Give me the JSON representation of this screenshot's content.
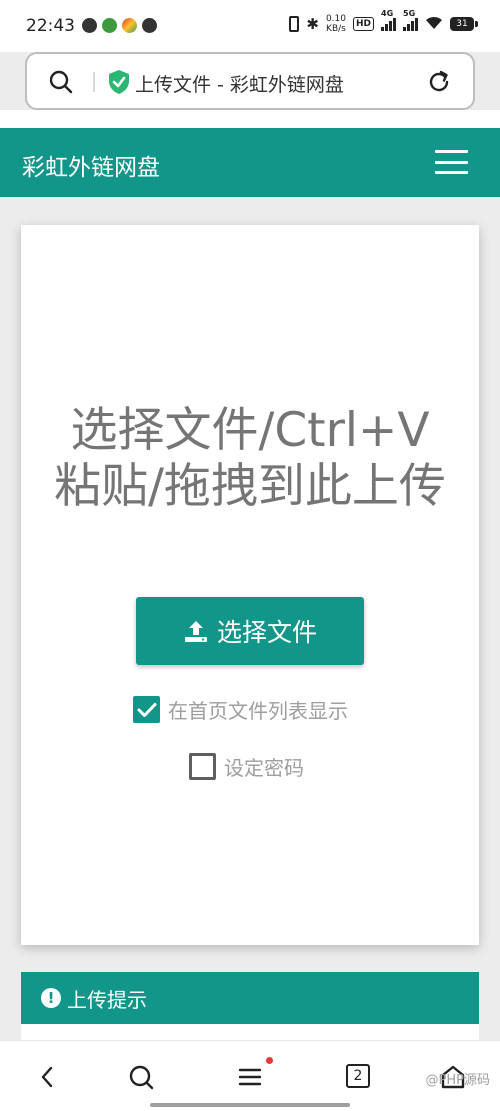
{
  "status_bar": {
    "time": "22:43",
    "net_speed_value": "0.10",
    "net_speed_unit": "KB/s",
    "hd_label": "HD",
    "signal1_label": "4G",
    "signal2_label": "5G",
    "battery": "31",
    "icons": [
      "notification-icon",
      "app-icon",
      "app-icon",
      "check-icon",
      "vibrate-icon",
      "bluetooth-icon",
      "wifi-icon",
      "battery-icon"
    ]
  },
  "address_bar": {
    "page_title": "上传文件 - 彩虹外链网盘",
    "icons": [
      "search-icon",
      "shield-check-icon",
      "reload-icon"
    ]
  },
  "navbar": {
    "brand": "彩虹外链网盘",
    "menu_icon": "hamburger-menu-icon"
  },
  "upload": {
    "drop_text": "选择文件/Ctrl+V粘贴/拖拽到此上传",
    "choose_button": "选择文件",
    "show_on_home_label": "在首页文件列表显示",
    "show_on_home_checked": true,
    "set_password_label": "设定密码",
    "set_password_checked": false
  },
  "tips": {
    "title": "上传提示"
  },
  "bottom_bar": {
    "tab_count": "2",
    "watermark": "@PHP源码",
    "icons": [
      "back-icon",
      "search-icon",
      "menu-icon",
      "tabs-icon",
      "home-icon"
    ]
  },
  "colors": {
    "accent": "#13968a",
    "text_muted": "#757575"
  }
}
